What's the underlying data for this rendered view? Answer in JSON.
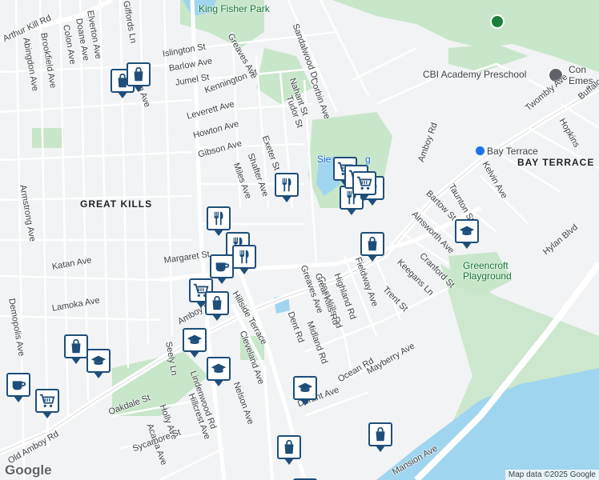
{
  "map": {
    "attribution": "Map data ©2025 Google",
    "logo": "Google",
    "areas": [
      {
        "id": "great-kills",
        "text": "GREAT KILLS"
      },
      {
        "id": "bay-terrace",
        "text": "BAY TERRACE"
      }
    ],
    "parks": [
      {
        "id": "king-fisher-park",
        "text": "King Fisher Park"
      },
      {
        "id": "greencroft-playground",
        "text": "Greencroft Playground"
      }
    ],
    "poi": {
      "preschool": "CBI Academy Preschool",
      "station": "Bay Terrace",
      "partial_left": "Sie",
      "partial_right": "g",
      "cut_right": "Con Emes"
    },
    "streets": [
      "Arthur Kill Rd",
      "Abingdon Ave",
      "Brookfield Ave",
      "Colon Ave",
      "Doane Ave",
      "Elverton Ave",
      "Giffords Ln",
      "Islington St",
      "Barlow Ave",
      "Jumel St",
      "Kennington St",
      "Leverett Ave",
      "Howton Ave",
      "Gibson Ave",
      "Greaves Ave",
      "Nahant St",
      "Tudor St",
      "Corbin Ave",
      "Sandalwood Dr",
      "Exeter St",
      "Shafter Ave",
      "Miles Ave",
      "Armstrong Ave",
      "Katan Ave",
      "Margaret St",
      "Lamoka Ave",
      "Great Kills Rd",
      "Hillside Terrace",
      "Cleveland Ave",
      "Dent Rd",
      "Midland Rd",
      "Highland Rd",
      "Fieldway Ave",
      "Keegans Ln",
      "Trent St",
      "Cranford St",
      "Ainsworth Ave",
      "Bartow St",
      "Taunton St",
      "Kelvin Ave",
      "Amboy Rd",
      "Twombly Ave",
      "Hopkins",
      "Buffalo",
      "Hylan Blvd",
      "Ocean Rd",
      "Mayberry Ave",
      "Durant Ave",
      "Nelson Ave",
      "Lindenwood Rd",
      "Hillcrest Ave",
      "Holly Ave",
      "Acacia Ave",
      "Oakdale St",
      "Sycamore St",
      "Old Amboy Rd",
      "Demopolis Ave",
      "Seely Ln",
      "Mansion Ave",
      "Stieg Ave",
      "Greaves Ave",
      "Great Kills Rd",
      "Amboy Rd"
    ],
    "markers": [
      {
        "type": "shopping"
      },
      {
        "type": "shopping"
      },
      {
        "type": "restaurant"
      },
      {
        "type": "restaurant"
      },
      {
        "type": "shopping"
      },
      {
        "type": "restaurant"
      },
      {
        "type": "shopping"
      },
      {
        "type": "school"
      },
      {
        "type": "restaurant"
      },
      {
        "type": "restaurant"
      },
      {
        "type": "cafe"
      },
      {
        "type": "grocery"
      },
      {
        "type": "shopping"
      },
      {
        "type": "school"
      },
      {
        "type": "shopping"
      },
      {
        "type": "school"
      },
      {
        "type": "school"
      },
      {
        "type": "cafe"
      },
      {
        "type": "grocery"
      },
      {
        "type": "school"
      },
      {
        "type": "shopping"
      },
      {
        "type": "shopping"
      },
      {
        "type": "shopping"
      }
    ]
  }
}
